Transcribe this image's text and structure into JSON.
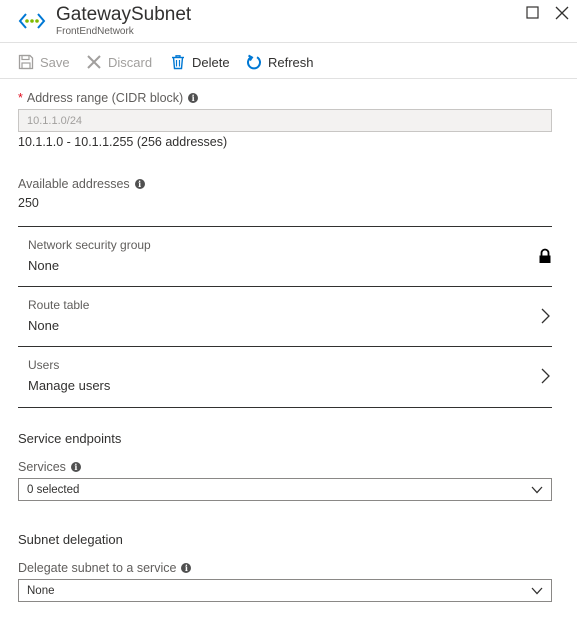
{
  "header": {
    "title": "GatewaySubnet",
    "subtitle": "FrontEndNetwork"
  },
  "toolbar": {
    "save_label": "Save",
    "discard_label": "Discard",
    "delete_label": "Delete",
    "refresh_label": "Refresh"
  },
  "address_range": {
    "required_marker": "*",
    "label": "Address range (CIDR block)",
    "value": "10.1.1.0/24",
    "range_text": "10.1.1.0 - 10.1.1.255 (256 addresses)"
  },
  "available_addresses": {
    "label": "Available addresses",
    "value": "250"
  },
  "rows": [
    {
      "label": "Network security group",
      "value": "None",
      "icon": "lock-icon"
    },
    {
      "label": "Route table",
      "value": "None",
      "icon": "chevron-right-icon"
    },
    {
      "label": "Users",
      "value": "Manage users",
      "icon": "chevron-right-icon"
    }
  ],
  "service_endpoints": {
    "title": "Service endpoints",
    "services_label": "Services",
    "services_value": "0 selected"
  },
  "subnet_delegation": {
    "title": "Subnet delegation",
    "delegate_label": "Delegate subnet to a service",
    "delegate_value": "None"
  },
  "info_glyph": "i",
  "colors": {
    "accent": "#0078d4",
    "required": "#e00b1c",
    "disabled": "#a19f9d",
    "text": "#323130"
  }
}
